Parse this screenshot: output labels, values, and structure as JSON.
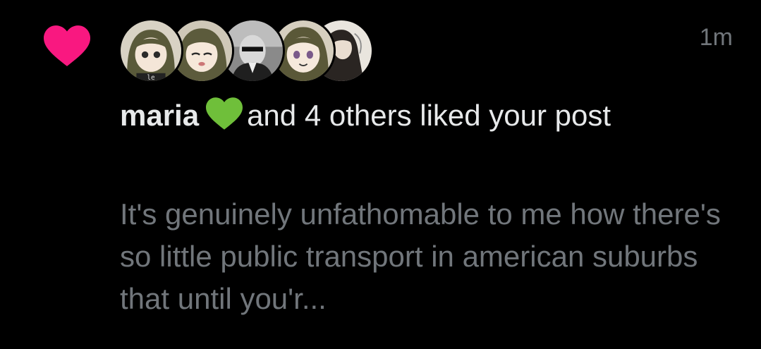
{
  "notification": {
    "type_icon": "heart-icon",
    "accent_color": "#f91880",
    "timestamp": "1m",
    "avatars": [
      {
        "name": "avatar-1",
        "caption": "le"
      },
      {
        "name": "avatar-2"
      },
      {
        "name": "avatar-3"
      },
      {
        "name": "avatar-4"
      },
      {
        "name": "avatar-5"
      }
    ],
    "user_name": "maria",
    "name_emoji": "green-heart-icon",
    "action_text": "and 4 others liked your post",
    "post_preview": "It's genuinely unfathomable to me how there's so little public transport in american suburbs that until you'r..."
  }
}
